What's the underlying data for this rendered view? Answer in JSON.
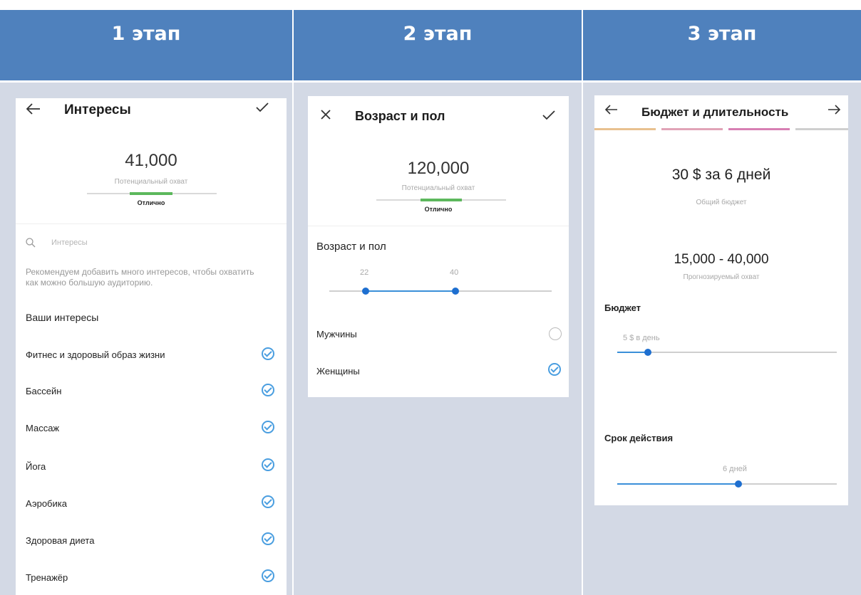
{
  "stages": [
    "1 этап",
    "2 этап",
    "3 этап"
  ],
  "panel1": {
    "title": "Интересы",
    "reach_value": "41,000",
    "reach_label": "Потенциальный охват",
    "quality": "Отлично",
    "search_placeholder": "Интересы",
    "hint": "Рекомендуем добавить много интересов, чтобы охватить как можно большую аудиторию.",
    "section_title": "Ваши интересы",
    "interests": [
      "Фитнес и здоровый образ жизни",
      "Бассейн",
      "Массаж",
      "Йога",
      "Аэробика",
      "Здоровая диета",
      "Тренажёр"
    ]
  },
  "panel2": {
    "title": "Возраст и пол",
    "reach_value": "120,000",
    "reach_label": "Потенциальный охват",
    "quality": "Отлично",
    "section_title": "Возраст и пол",
    "age_min": "22",
    "age_max": "40",
    "gender_male": "Мужчины",
    "gender_female": "Женщины",
    "male_selected": false,
    "female_selected": true
  },
  "panel3": {
    "title": "Бюджет и длительность",
    "total": "30 $ за 6 дней",
    "total_label": "Общий бюджет",
    "forecast": "15,000 - 40,000",
    "forecast_label": "Прогнозируемый охват",
    "budget_title": "Бюджет",
    "budget_value": "5 $ в день",
    "duration_title": "Срок действия",
    "duration_value": "6 дней"
  },
  "colors": {
    "header_bg": "#4f81bd",
    "body_bg": "#d3d9e5",
    "accent": "#3a8fd9",
    "gauge_good": "#5cb85c",
    "progress": [
      "#e8c18f",
      "#e1a3b7",
      "#d77fb3",
      "#cfcfcf"
    ]
  }
}
